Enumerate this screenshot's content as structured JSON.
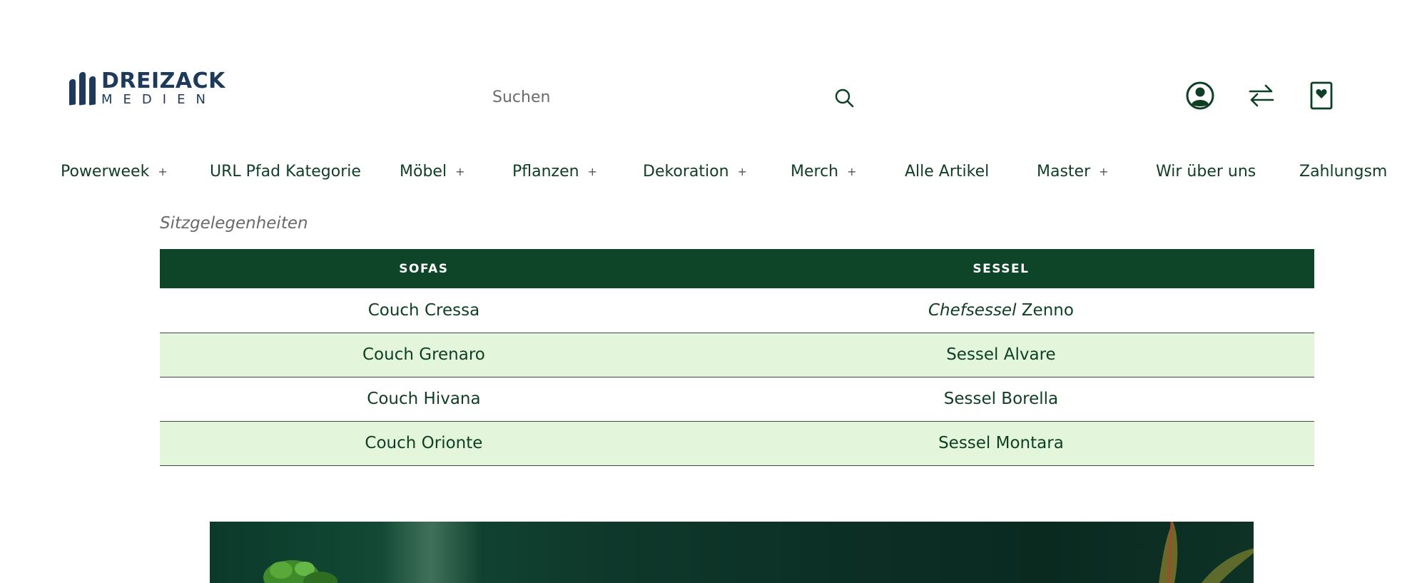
{
  "header": {
    "logo": {
      "line1": "DREIZACK",
      "line2": "MEDIEN"
    },
    "search": {
      "placeholder": "Suchen"
    },
    "icons": [
      "account-icon",
      "compare-icon",
      "wishlist-icon"
    ]
  },
  "nav": {
    "items": [
      {
        "label": "Powerweek",
        "has_submenu": true
      },
      {
        "label": "URL Pfad Kategorie",
        "has_submenu": false
      },
      {
        "label": "Möbel",
        "has_submenu": true
      },
      {
        "label": "Pflanzen",
        "has_submenu": true
      },
      {
        "label": "Dekoration",
        "has_submenu": true
      },
      {
        "label": "Merch",
        "has_submenu": true
      },
      {
        "label": "Alle Artikel",
        "has_submenu": false
      },
      {
        "label": "Master",
        "has_submenu": true
      },
      {
        "label": "Wir über uns",
        "has_submenu": false
      },
      {
        "label": "Zahlungsm",
        "has_submenu": false
      }
    ],
    "plus_symbol": "+"
  },
  "content": {
    "section_label": "Sitzgelegenheiten",
    "table": {
      "headers": [
        "SOFAS",
        "SESSEL"
      ],
      "rows": [
        {
          "sofa": "Couch Cressa",
          "sessel_italic": "Chefsessel",
          "sessel": "Zenno"
        },
        {
          "sofa": "Couch Grenaro",
          "sessel_italic": "",
          "sessel": "Sessel Alvare"
        },
        {
          "sofa": "Couch Hivana",
          "sessel_italic": "",
          "sessel": "Sessel Borella"
        },
        {
          "sofa": "Couch Orionte",
          "sessel_italic": "",
          "sessel": "Sessel Montara"
        }
      ]
    }
  },
  "colors": {
    "brand_dark_green": "#0e4428",
    "row_alt_green": "#e3f5da",
    "text_green": "#0e3f24",
    "logo_blue": "#1d3a5a"
  }
}
